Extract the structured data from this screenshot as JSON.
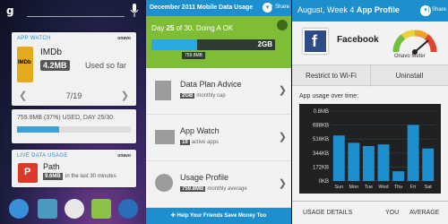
{
  "home": {
    "app_watch": {
      "label": "APP WATCH",
      "brand": "onavo",
      "app_name": "IMDb",
      "badge": "4.2MB",
      "used_text": "Used so far",
      "page": "7/19",
      "icon_text": "IMDb"
    },
    "usage": {
      "text": "759.8MB (37%) USED, DAY 25/30",
      "fraction": 0.37
    },
    "live_data": {
      "label": "LIVE DATA USAGE",
      "brand": "onavo",
      "app_name": "Path",
      "badge": "9.6MB",
      "text": "in the last 30 minutes",
      "icon_text": "P"
    },
    "search_g": "g"
  },
  "data_usage": {
    "header_title": "December 2011  Mobile Data Usage",
    "share": "Share",
    "day_text_pre": "Day ",
    "day_num": "25",
    "day_text_mid": " of 30. Doing A OK",
    "bar_label": "2GB",
    "bar_fraction": 0.37,
    "bar_tip": "759.8MB",
    "rows": [
      {
        "title": "Data Plan Advice",
        "badge": "2GB",
        "sub": "monthly cap"
      },
      {
        "title": "App Watch",
        "badge": "19",
        "sub": "active apps"
      },
      {
        "title": "Usage Profile",
        "badge": "759.8MB",
        "sub": "monthly average"
      }
    ],
    "footer": "Help Your Friends Save Money Too"
  },
  "app_profile": {
    "header_pre": "August, Week 4 ",
    "header_bold": "App Profile",
    "share": "Share",
    "app_name": "Facebook",
    "meter_label": "Onavo Meter",
    "btn_restrict": "Restrict to Wi-Fi",
    "btn_uninstall": "Uninstall",
    "chart_label": "App usage over time:",
    "footer_left": "USAGE DETAILS",
    "footer_mid": "YOU",
    "footer_right": "AVERAGE",
    "icon_text": "f"
  },
  "chart_data": {
    "type": "bar",
    "title": "App usage over time:",
    "categories": [
      "Sun",
      "Mon",
      "Tue",
      "Wed",
      "Thu",
      "Fri",
      "Sat"
    ],
    "y_ticks": [
      "0.8MB",
      "688KB",
      "516KB",
      "344KB",
      "172KB",
      "0KB"
    ],
    "ylim": [
      0,
      860
    ],
    "unit": "KB",
    "series": [
      {
        "values": [
          560,
          470,
          430,
          450,
          120,
          690,
          400
        ]
      }
    ],
    "grid": true,
    "colors": {
      "bar": "#1d8fcc",
      "background": "#1f2122",
      "grid": "#3a3d3f"
    }
  },
  "colors": {
    "accent": "#1d8fcc",
    "green": "#7fbd36",
    "imdb": "#e5a91c",
    "path": "#d93a2a",
    "facebook": "#2f4b85"
  }
}
